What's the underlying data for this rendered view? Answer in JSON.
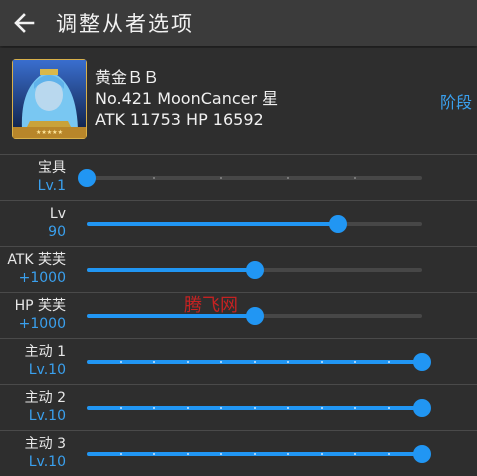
{
  "header": {
    "title": "调整从者选项",
    "back_icon": "arrow-left-icon"
  },
  "servant": {
    "name": "黄金ＢＢ",
    "line2": "No.421  MoonCancer  星",
    "line3": "ATK 11753  HP 16592",
    "stage_label": "阶段",
    "portrait_icon": "servant-portrait",
    "rarity_stars": 5,
    "accent": "#3aa0ee"
  },
  "sliders": [
    {
      "key": "np",
      "label": "宝具",
      "value_text": "Lv.1",
      "level": 0,
      "steps": 5
    },
    {
      "key": "lv",
      "label": "Lv",
      "value_text": "90",
      "level": 0.75,
      "steps": 0
    },
    {
      "key": "atk_fou",
      "label": "ATK 芙芙",
      "value_text": "+1000",
      "level": 0.5,
      "steps": 0
    },
    {
      "key": "hp_fou",
      "label": "HP 芙芙",
      "value_text": "+1000",
      "level": 0.5,
      "steps": 0
    },
    {
      "key": "skill1",
      "label": "主动 1",
      "value_text": "Lv.10",
      "level": 1,
      "steps": 10
    },
    {
      "key": "skill2",
      "label": "主动 2",
      "value_text": "Lv.10",
      "level": 1,
      "steps": 10
    },
    {
      "key": "skill3",
      "label": "主动 3",
      "value_text": "Lv.10",
      "level": 1,
      "steps": 10
    }
  ],
  "watermark": "腾飞网",
  "colors": {
    "accent": "#2196f3",
    "text_blue": "#3aa0ee",
    "background": "#2e2e2e",
    "topbar": "#3b3b3b"
  }
}
